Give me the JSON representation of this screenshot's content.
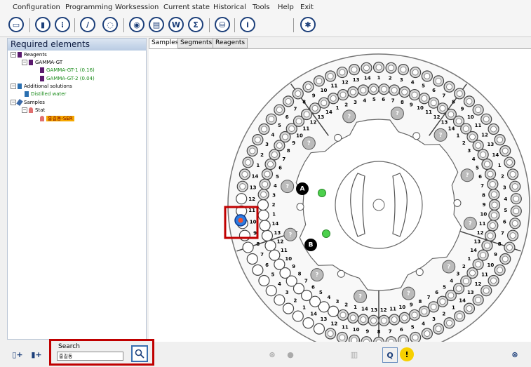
{
  "menu": [
    "Configuration",
    "Programming",
    "Worksession",
    "Current state",
    "Historical",
    "Tools",
    "Help",
    "Exit"
  ],
  "toolbar_icons": [
    "folder-open-icon",
    "reagent-bottle-icon",
    "sample-rack-icon",
    "calibration-icon",
    "rotor-icon",
    "eye-icon",
    "report-icon",
    "w-results-icon",
    "sigma-icon",
    "database-icon",
    "info-icon",
    "star-icon"
  ],
  "left_panel": {
    "title": "Required elements",
    "tree": [
      {
        "label": "Reagents",
        "level": 0
      },
      {
        "label": "GAMMA-GT",
        "level": 1
      },
      {
        "label": "GAMMA-GT-1 (0.16)",
        "level": 2
      },
      {
        "label": "GAMMA-GT-2 (0.04)",
        "level": 2
      },
      {
        "label": "Additional solutions",
        "level": 0
      },
      {
        "label": "Distilled water",
        "level": 1
      },
      {
        "label": "Samples",
        "level": 0
      },
      {
        "label": "Stat",
        "level": 1
      },
      {
        "label": "홍길동-SER",
        "level": 2
      }
    ]
  },
  "tabs": [
    "Samples",
    "Segments",
    "Reagents"
  ],
  "rotor": {
    "marker_a": "A",
    "marker_b": "B",
    "unknown_glyph": "?",
    "inner_outer_numbers": [
      "1",
      "2",
      "3",
      "4",
      "5",
      "6",
      "7",
      "8",
      "9",
      "10",
      "11",
      "12",
      "13",
      "14"
    ]
  },
  "search": {
    "label": "Search",
    "value": "홍길동"
  },
  "colors": {
    "highlight": "#c00000",
    "accent": "#1c3f7a",
    "selected_sample": "#f6a800"
  }
}
